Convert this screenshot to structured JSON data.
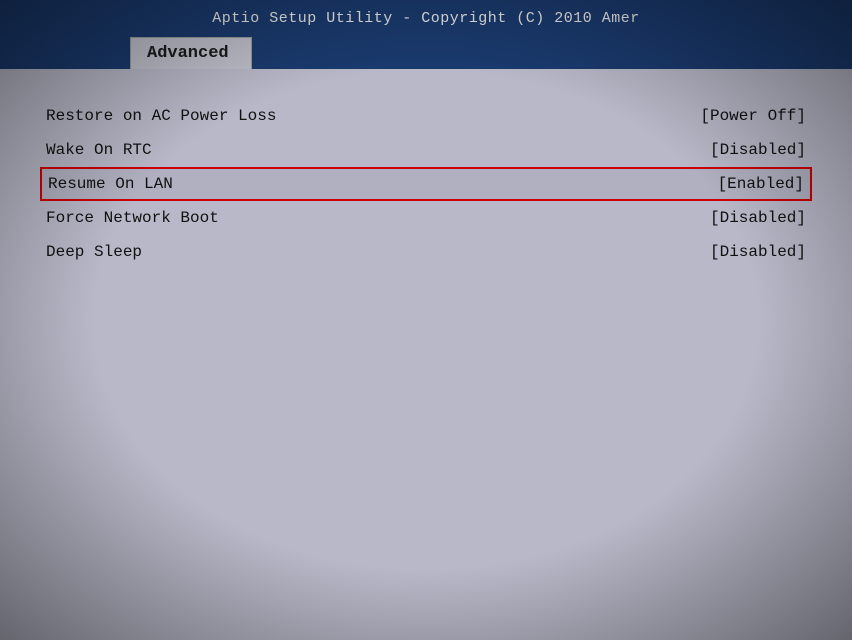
{
  "header": {
    "title": "Aptio Setup Utility - Copyright (C) 2010 Amer"
  },
  "tab": {
    "label": "Advanced"
  },
  "settings": [
    {
      "label": "Restore on AC Power Loss",
      "value": "[Power Off]",
      "highlighted": false
    },
    {
      "label": "Wake On RTC",
      "value": "[Disabled]",
      "highlighted": false
    },
    {
      "label": "Resume On LAN",
      "value": "[Enabled]",
      "highlighted": true
    },
    {
      "label": "Force Network Boot",
      "value": "[Disabled]",
      "highlighted": false
    },
    {
      "label": "Deep Sleep",
      "value": "[Disabled]",
      "highlighted": false
    }
  ]
}
